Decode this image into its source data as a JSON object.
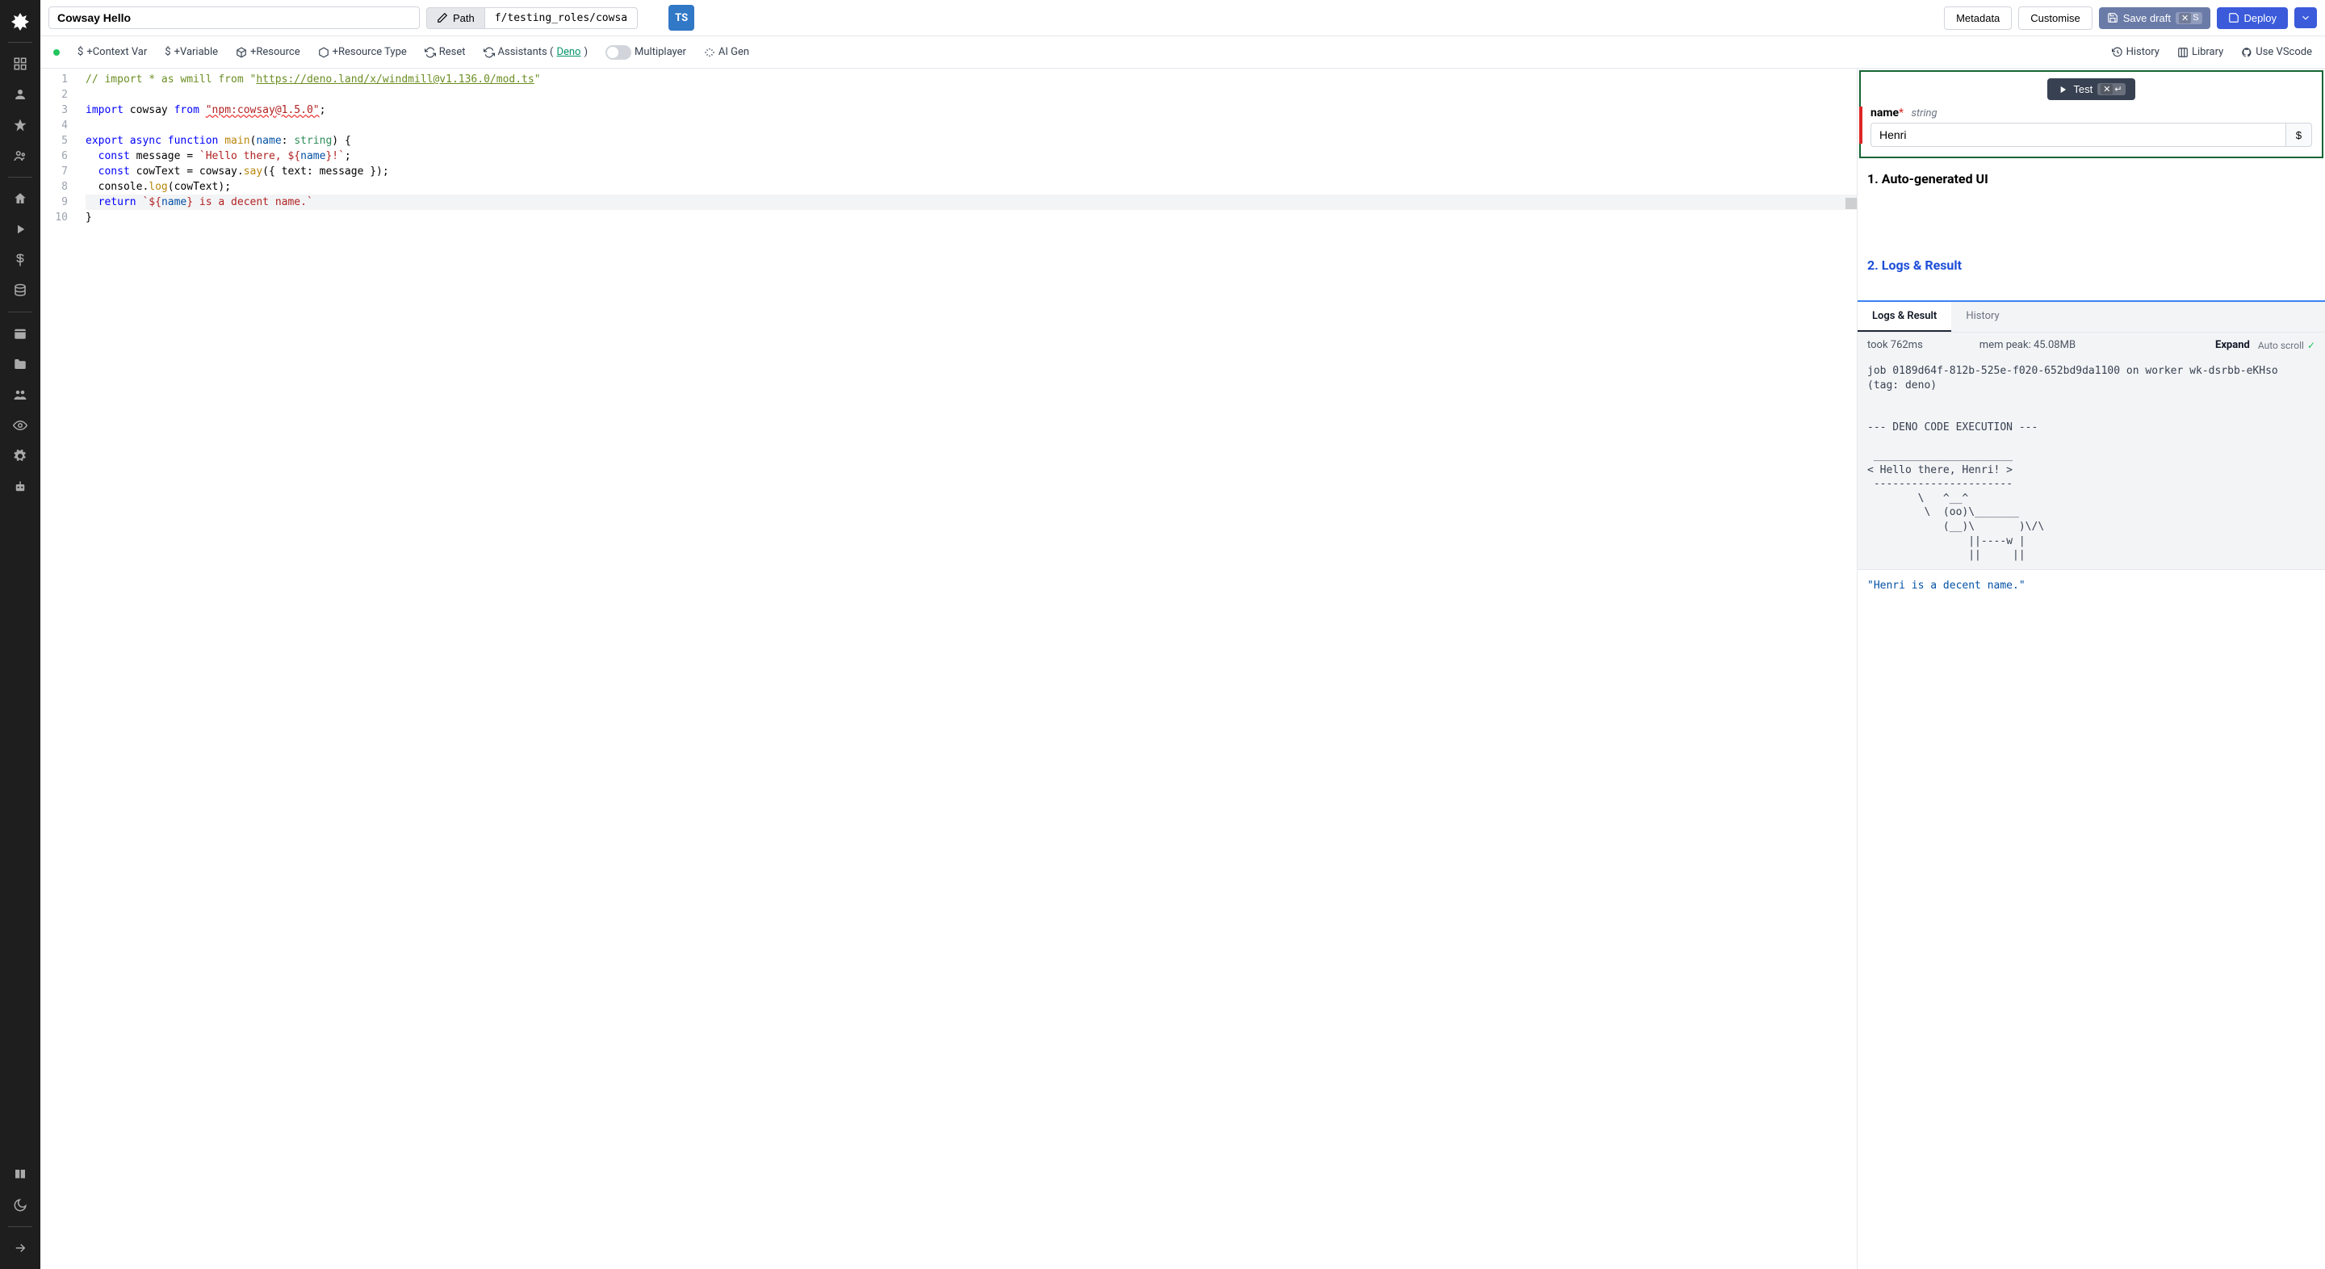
{
  "header": {
    "title": "Cowsay Hello",
    "path_label": "Path",
    "path_value": "f/testing_roles/cowsa",
    "lang_badge": "TS",
    "metadata_btn": "Metadata",
    "customise_btn": "Customise",
    "save_draft_btn": "Save draft",
    "save_draft_kbd_x": "✕",
    "save_draft_kbd_s": "S",
    "deploy_btn": "Deploy"
  },
  "toolbar": {
    "context_var": "+Context Var",
    "variable": "+Variable",
    "resource": "+Resource",
    "resource_type": "+Resource Type",
    "reset": "Reset",
    "assistants_prefix": "Assistants (",
    "assistants_link": "Deno",
    "assistants_suffix": ")",
    "multiplayer": "Multiplayer",
    "ai_gen": "AI Gen",
    "history": "History",
    "library": "Library",
    "use_vscode": "Use VScode"
  },
  "editor": {
    "lines": [
      "1",
      "2",
      "3",
      "4",
      "5",
      "6",
      "7",
      "8",
      "9",
      "10"
    ],
    "l1_a": "// import * as wmill from \"",
    "l1_b": "https://deno.land/x/windmill@v1.136.0/mod.ts",
    "l1_c": "\"",
    "l3_a": "import",
    "l3_b": " cowsay ",
    "l3_c": "from",
    "l3_d": " ",
    "l3_e": "\"npm:cowsay@1.5.0\"",
    "l3_f": ";",
    "l5_a": "export",
    "l5_b": " ",
    "l5_c": "async",
    "l5_d": " ",
    "l5_e": "function",
    "l5_f": " ",
    "l5_g": "main",
    "l5_h": "(",
    "l5_i": "name",
    "l5_j": ": ",
    "l5_k": "string",
    "l5_l": ") {",
    "l6_a": "  ",
    "l6_b": "const",
    "l6_c": " message = ",
    "l6_d": "`Hello there, ${",
    "l6_e": "name",
    "l6_f": "}!`",
    "l6_g": ";",
    "l7_a": "  ",
    "l7_b": "const",
    "l7_c": " cowText = cowsay.",
    "l7_d": "say",
    "l7_e": "({ text: message });",
    "l8_a": "  console.",
    "l8_b": "log",
    "l8_c": "(cowText);",
    "l9_a": "  ",
    "l9_b": "return",
    "l9_c": " ",
    "l9_d": "`${",
    "l9_e": "name",
    "l9_f": "} is a decent name.`",
    "l10": "}"
  },
  "right": {
    "test_btn": "Test",
    "test_kbd_x": "✕",
    "test_kbd_enter": "↵",
    "param_name": "name",
    "param_required": "*",
    "param_type": "string",
    "param_value": "Henri",
    "section_autogen": "1. Auto-generated UI",
    "section_logs": "2. Logs & Result",
    "tab_logs": "Logs & Result",
    "tab_history": "History",
    "took": "took 762ms",
    "mem_peak": "mem peak: 45.08MB",
    "expand": "Expand",
    "auto_scroll": "Auto scroll",
    "log_output": "job 0189d64f-812b-525e-f020-652bd9da1100 on worker wk-dsrbb-eKHso (tag: deno)\n\n\n--- DENO CODE EXECUTION ---\n\n ______________________\n< Hello there, Henri! >\n ----------------------\n        \\   ^__^\n         \\  (oo)\\_______\n            (__)\\       )\\/\\\n                ||----w |\n                ||     ||",
    "result": "\"Henri is a decent name.\""
  }
}
